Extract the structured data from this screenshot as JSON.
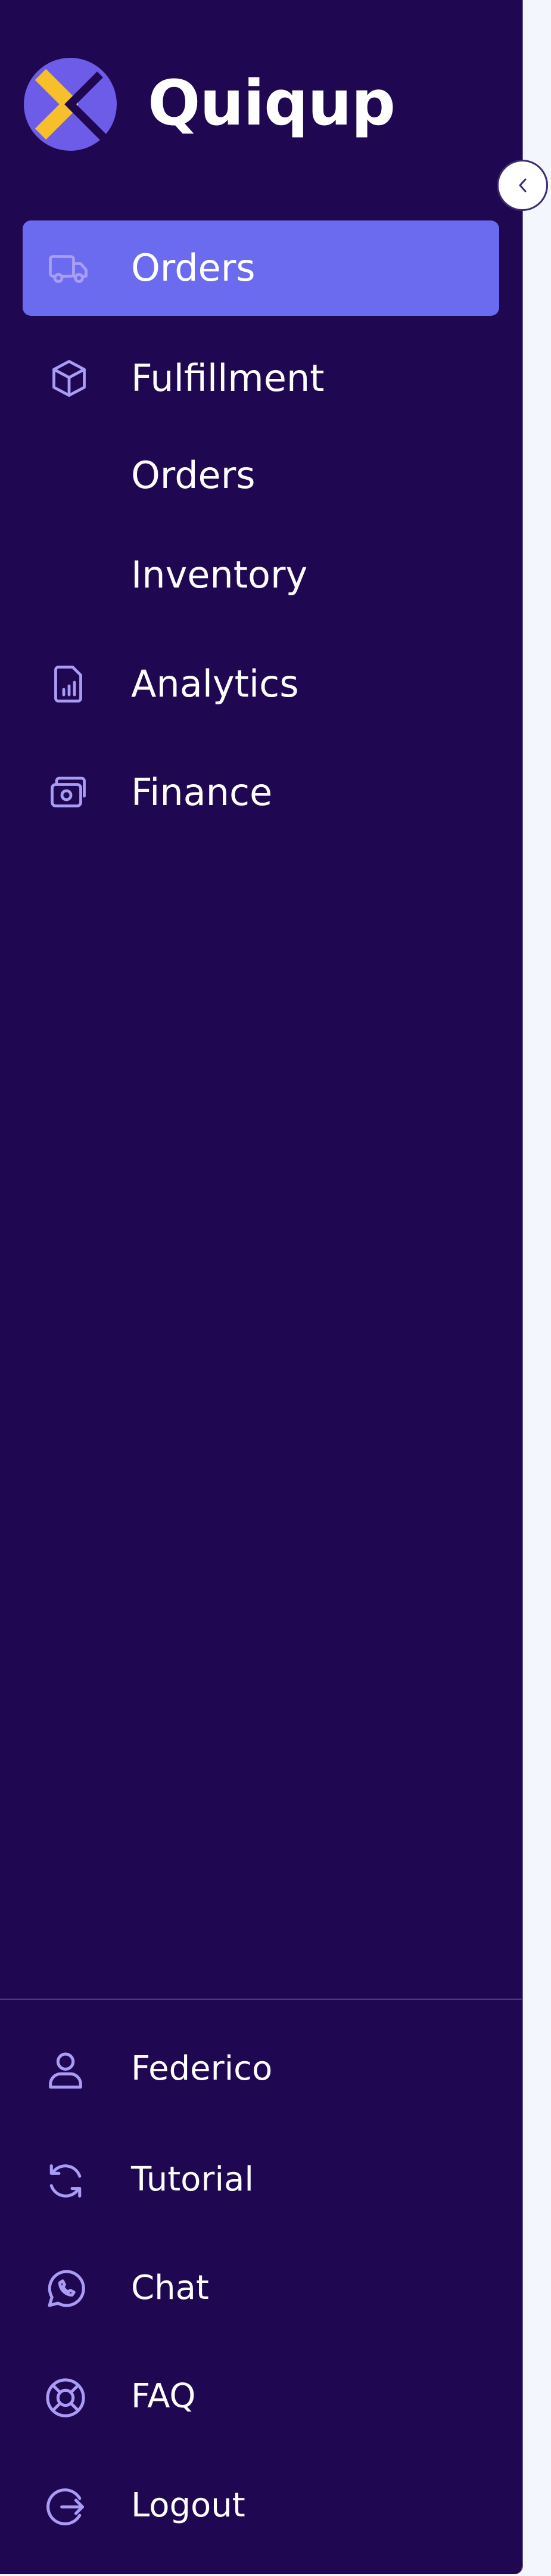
{
  "app": {
    "brand_name": "Quiqup"
  },
  "colors": {
    "sidebar_bg": "#1f0751",
    "active_bg": "#6b6bf0",
    "icon_color": "#a99cf5",
    "logo_purple": "#6c5ce7",
    "logo_yellow": "#f7c02b"
  },
  "icons": {
    "orders": "truck-icon",
    "fulfillment": "box-icon",
    "analytics": "report-icon",
    "finance": "wallet-icon",
    "user": "user-icon",
    "tutorial": "refresh-icon",
    "chat": "whatsapp-icon",
    "faq": "lifebuoy-icon",
    "logout": "logout-icon",
    "collapse": "chevron-left-icon"
  },
  "nav": {
    "orders": "Orders",
    "fulfillment": "Fulfillment",
    "fulfillment_orders": "Orders",
    "fulfillment_inventory": "Inventory",
    "analytics": "Analytics",
    "finance": "Finance"
  },
  "footer": {
    "user": "Federico",
    "tutorial": "Tutorial",
    "chat": "Chat",
    "faq": "FAQ",
    "logout": "Logout"
  }
}
